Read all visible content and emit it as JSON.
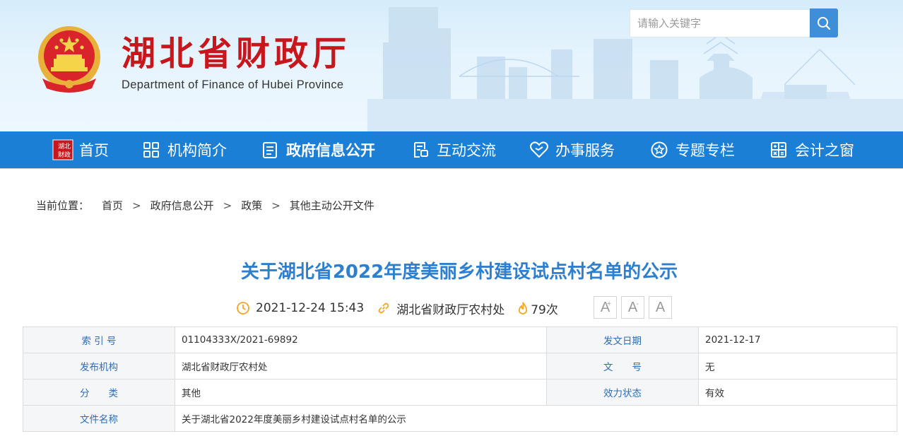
{
  "header": {
    "title": "湖北省财政厅",
    "subtitle": "Department of Finance of Hubei Province",
    "search_placeholder": "请输入关键字"
  },
  "nav": [
    {
      "label": "首页",
      "icon": "hubei-finance-logo-icon"
    },
    {
      "label": "机构简介",
      "icon": "grid-icon"
    },
    {
      "label": "政府信息公开",
      "icon": "document-list-icon",
      "active": true
    },
    {
      "label": "互动交流",
      "icon": "chat-document-icon"
    },
    {
      "label": "办事服务",
      "icon": "heart-icon"
    },
    {
      "label": "专题专栏",
      "icon": "star-circle-icon"
    },
    {
      "label": "会计之窗",
      "icon": "calculator-icon"
    }
  ],
  "breadcrumb": {
    "lead": "当前位置：",
    "items": [
      "首页",
      "政府信息公开",
      "政策",
      "其他主动公开文件"
    ],
    "separator": ">"
  },
  "article": {
    "title": "关于湖北省2022年度美丽乡村建设试点村名单的公示",
    "datetime": "2021-12-24 15:43",
    "source": "湖北省财政厅农村处",
    "views": "79次",
    "font_buttons": [
      "A",
      "A",
      "A"
    ],
    "font_button_marks": [
      "+",
      "-",
      ""
    ]
  },
  "info_table": {
    "rows": [
      {
        "k1": "索 引 号",
        "v1": "01104333X/2021-69892",
        "k2": "发文日期",
        "v2": "2021-12-17"
      },
      {
        "k1": "发布机构",
        "v1": "湖北省财政厅农村处",
        "k2": "文　　号",
        "v2": "无"
      },
      {
        "k1": "分　　类",
        "v1": "其他",
        "k2": "效力状态",
        "v2": "有效"
      },
      {
        "k1": "文件名称",
        "v1": "关于湖北省2022年度美丽乡村建设试点村名单的公示"
      }
    ]
  },
  "colors": {
    "nav_bg": "#1b7fd6",
    "title_red": "#c8161d",
    "article_title_blue": "#2f7fcf",
    "meta_icon_orange": "#f5a623",
    "table_key_blue": "#2d6db5"
  }
}
